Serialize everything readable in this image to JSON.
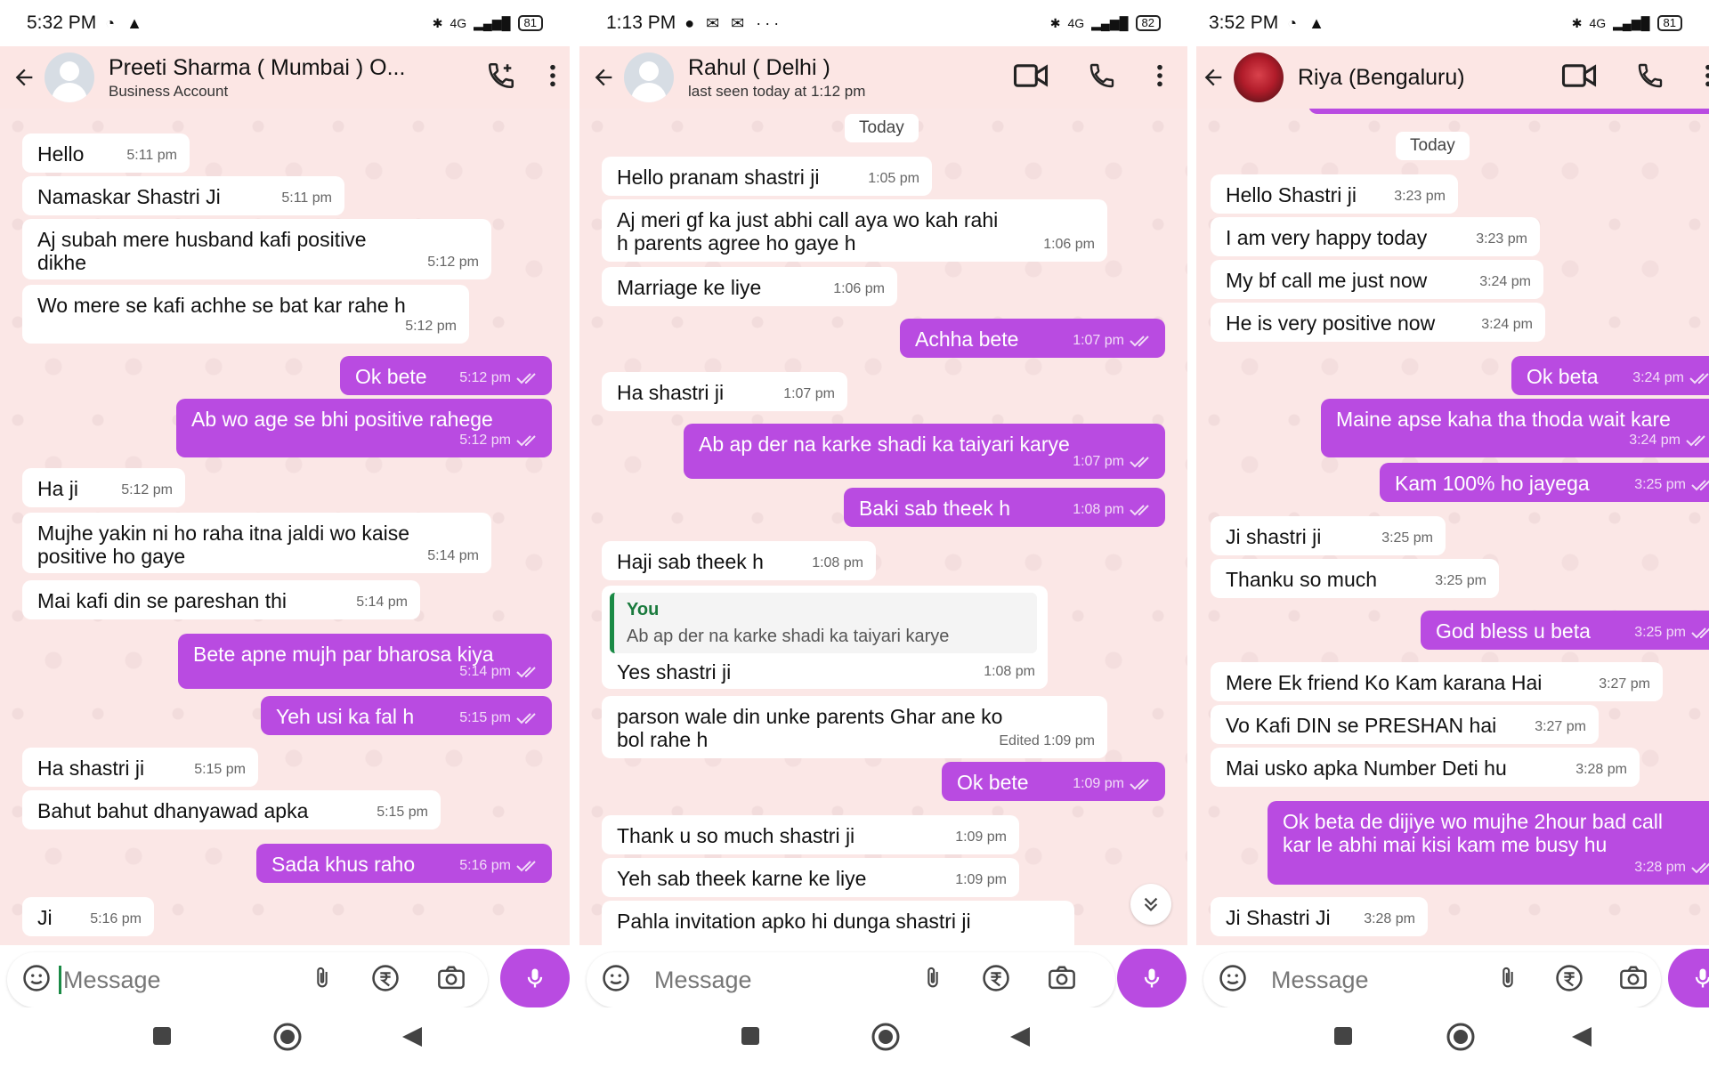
{
  "panel1": {
    "status": {
      "time": "5:32 PM",
      "battery": "81",
      "network": "4G"
    },
    "header": {
      "name": "Preeti Sharma ( Mumbai ) O...",
      "subtitle": "Business Account"
    },
    "messages": [
      {
        "dir": "in",
        "text": "Hello",
        "time": "5:11 pm"
      },
      {
        "dir": "in",
        "text": "Namaskar Shastri Ji",
        "time": "5:11 pm"
      },
      {
        "dir": "in",
        "text": "Aj subah mere husband kafi positive",
        "text2": "dikhe",
        "time": "5:12 pm"
      },
      {
        "dir": "in",
        "text": "Wo mere se kafi achhe se bat kar rahe h",
        "time": "5:12 pm"
      },
      {
        "dir": "out",
        "text": "Ok bete",
        "time": "5:12 pm"
      },
      {
        "dir": "out",
        "text": "Ab wo age se bhi positive rahege",
        "time": "5:12 pm"
      },
      {
        "dir": "in",
        "text": "Ha ji",
        "time": "5:12 pm"
      },
      {
        "dir": "in",
        "text": "Mujhe yakin ni ho raha itna jaldi wo kaise",
        "text2": "positive ho gaye",
        "time": "5:14 pm"
      },
      {
        "dir": "in",
        "text": "Mai kafi din se pareshan thi",
        "time": "5:14 pm"
      },
      {
        "dir": "out",
        "text": "Bete apne mujh par bharosa kiya",
        "time": "5:14 pm"
      },
      {
        "dir": "out",
        "text": "Yeh usi ka fal h",
        "time": "5:15 pm"
      },
      {
        "dir": "in",
        "text": "Ha shastri ji",
        "time": "5:15 pm"
      },
      {
        "dir": "in",
        "text": "Bahut bahut dhanyawad apka",
        "time": "5:15 pm"
      },
      {
        "dir": "out",
        "text": "Sada khus raho",
        "time": "5:16 pm"
      },
      {
        "dir": "in",
        "text": "Ji",
        "time": "5:16 pm"
      }
    ],
    "input_placeholder": "Message"
  },
  "panel2": {
    "status": {
      "time": "1:13 PM",
      "battery": "82",
      "network": "4G"
    },
    "header": {
      "name": "Rahul ( Delhi )",
      "subtitle": "last seen today at 1:12 pm"
    },
    "date_chip": "Today",
    "messages": [
      {
        "dir": "in",
        "text": "Hello pranam shastri ji",
        "time": "1:05 pm"
      },
      {
        "dir": "in",
        "text": "Aj meri gf ka just abhi call aya wo kah rahi",
        "text2": "h parents agree ho gaye h",
        "time": "1:06 pm"
      },
      {
        "dir": "in",
        "text": "Marriage ke liye",
        "time": "1:06 pm"
      },
      {
        "dir": "out",
        "text": "Achha bete",
        "time": "1:07 pm"
      },
      {
        "dir": "in",
        "text": "Ha shastri ji",
        "time": "1:07 pm"
      },
      {
        "dir": "out",
        "text": "Ab ap der na karke shadi ka taiyari karye",
        "time": "1:07 pm"
      },
      {
        "dir": "out",
        "text": "Baki sab theek h",
        "time": "1:08 pm"
      },
      {
        "dir": "in",
        "text": "Haji sab theek h",
        "time": "1:08 pm"
      },
      {
        "dir": "in",
        "quote_author": "You",
        "quote_text": "Ab ap der na karke shadi ka taiyari karye",
        "text": "Yes shastri ji",
        "time": "1:08 pm"
      },
      {
        "dir": "in",
        "text": "parson wale din unke parents Ghar ane ko",
        "text2": "bol rahe h",
        "time": "Edited 1:09 pm"
      },
      {
        "dir": "out",
        "text": "Ok bete",
        "time": "1:09 pm"
      },
      {
        "dir": "in",
        "text": "Thank u so much shastri ji",
        "time": "1:09 pm"
      },
      {
        "dir": "in",
        "text": "Yeh sab theek karne ke liye",
        "time": "1:09 pm"
      },
      {
        "dir": "in",
        "text": "Pahla invitation apko hi dunga shastri ji",
        "time": ""
      }
    ],
    "input_placeholder": "Message"
  },
  "panel3": {
    "status": {
      "time": "3:52 PM",
      "battery": "81",
      "network": "4G"
    },
    "header": {
      "name": "Riya (Bengaluru)",
      "subtitle": ""
    },
    "date_chip": "Today",
    "messages": [
      {
        "dir": "in",
        "text": "Hello Shastri ji",
        "time": "3:23 pm"
      },
      {
        "dir": "in",
        "text": "I am very happy today",
        "time": "3:23 pm"
      },
      {
        "dir": "in",
        "text": "My bf call me just now",
        "time": "3:24 pm"
      },
      {
        "dir": "in",
        "text": "He is very positive now",
        "time": "3:24 pm"
      },
      {
        "dir": "out",
        "text": "Ok beta",
        "time": "3:24 pm"
      },
      {
        "dir": "out",
        "text": "Maine apse kaha tha thoda wait kare",
        "time": "3:24 pm"
      },
      {
        "dir": "out",
        "text": "Kam 100% ho jayega",
        "time": "3:25 pm"
      },
      {
        "dir": "in",
        "text": "Ji shastri ji",
        "time": "3:25 pm"
      },
      {
        "dir": "in",
        "text": "Thanku so much",
        "time": "3:25 pm"
      },
      {
        "dir": "out",
        "text": "God bless u beta",
        "time": "3:25 pm"
      },
      {
        "dir": "in",
        "text": "Mere Ek friend Ko Kam karana Hai",
        "time": "3:27 pm"
      },
      {
        "dir": "in",
        "text": "Vo Kafi DIN se PRESHAN hai",
        "time": "3:27 pm"
      },
      {
        "dir": "in",
        "text": "Mai usko apka Number Deti hu",
        "time": "3:28 pm"
      },
      {
        "dir": "out",
        "text": "Ok beta de dijiye wo mujhe 2hour bad call",
        "text2": "kar le abhi mai kisi kam me busy hu",
        "time": "3:28 pm"
      },
      {
        "dir": "in",
        "text": "Ji Shastri Ji",
        "time": "3:28 pm"
      }
    ],
    "input_placeholder": "Message"
  },
  "colors": {
    "outgoing": "#b94be1",
    "incoming": "#ffffff",
    "header": "#fce6e4",
    "chat_bg": "#fbe7e6",
    "quote_bar": "#1a8a45"
  },
  "icons": [
    "back-arrow",
    "add-call",
    "video-call",
    "voice-call",
    "more-vert",
    "sticker",
    "attach",
    "rupee-payment",
    "camera",
    "microphone",
    "double-check",
    "chevron-double-down",
    "nav-recents",
    "nav-home",
    "nav-back"
  ]
}
